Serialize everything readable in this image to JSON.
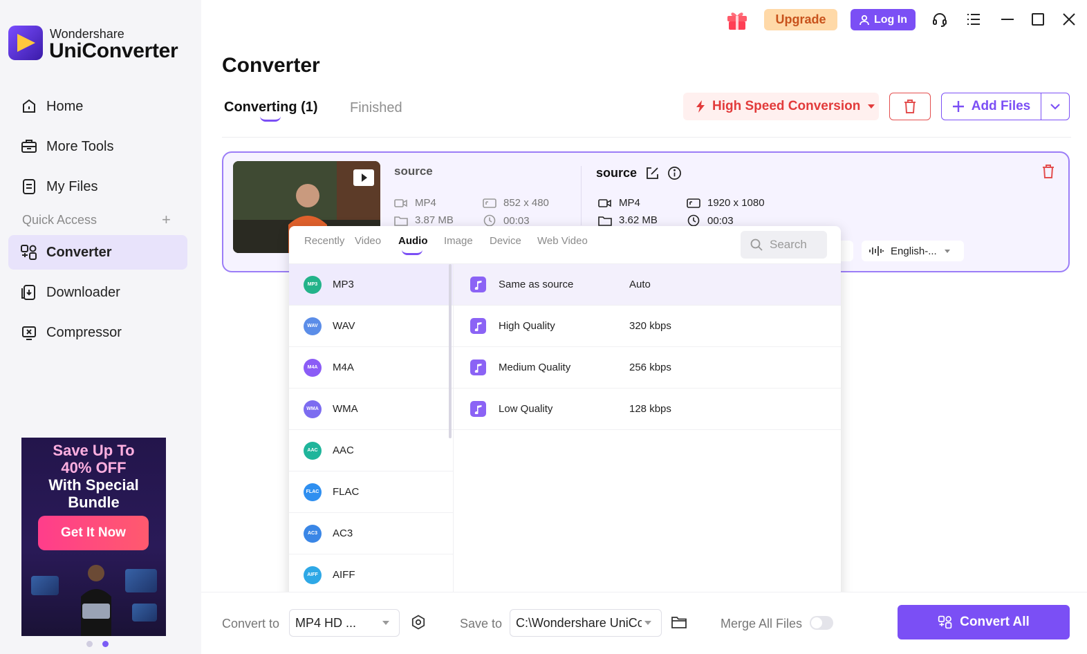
{
  "app": {
    "brand_top": "Wondershare",
    "brand_main": "UniConverter"
  },
  "sidebar": {
    "items": [
      {
        "label": "Home",
        "icon": "home-icon"
      },
      {
        "label": "More Tools",
        "icon": "toolbox-icon"
      },
      {
        "label": "My Files",
        "icon": "files-icon"
      }
    ],
    "quick_access_label": "Quick Access",
    "quick_items": [
      {
        "label": "Converter",
        "icon": "converter-icon",
        "active": true
      },
      {
        "label": "Downloader",
        "icon": "downloader-icon"
      },
      {
        "label": "Compressor",
        "icon": "compressor-icon"
      }
    ],
    "promo": {
      "line1": "Save Up To",
      "line2": "40% OFF",
      "line3": "With Special",
      "line4": "Bundle",
      "button": "Get It Now"
    }
  },
  "topbar": {
    "upgrade_label": "Upgrade",
    "login_label": "Log In"
  },
  "main": {
    "title": "Converter",
    "tabs": [
      {
        "label": "Converting (1)",
        "active": true
      },
      {
        "label": "Finished"
      }
    ],
    "high_speed_label": "High Speed Conversion",
    "add_files_label": "Add Files"
  },
  "file": {
    "source_title": "source",
    "source": {
      "format": "MP4",
      "size": "3.87 MB",
      "resolution": "852 x 480",
      "duration": "00:03"
    },
    "output_title": "source",
    "output": {
      "format": "MP4",
      "size": "3.62 MB",
      "resolution": "1920 x 1080",
      "duration": "00:03"
    },
    "audio_track": "English-..."
  },
  "format_panel": {
    "tabs": [
      "Recently",
      "Video",
      "Audio",
      "Image",
      "Device",
      "Web Video"
    ],
    "active_tab": "Audio",
    "search_placeholder": "Search",
    "formats": [
      {
        "label": "MP3",
        "badge": "MP3",
        "color": "#23b38a"
      },
      {
        "label": "WAV",
        "badge": "WAV",
        "color": "#5b8de8"
      },
      {
        "label": "M4A",
        "badge": "M4A",
        "color": "#8b5cf6"
      },
      {
        "label": "WMA",
        "badge": "WMA",
        "color": "#7c6cf0"
      },
      {
        "label": "AAC",
        "badge": "AAC",
        "color": "#1fb59b"
      },
      {
        "label": "FLAC",
        "badge": "FLAC",
        "color": "#2f8ff0"
      },
      {
        "label": "AC3",
        "badge": "AC3",
        "color": "#3a86e6"
      },
      {
        "label": "AIFF",
        "badge": "AIFF",
        "color": "#2ea8e6"
      }
    ],
    "qualities": [
      {
        "name": "Same as source",
        "bitrate": "Auto"
      },
      {
        "name": "High Quality",
        "bitrate": "320 kbps"
      },
      {
        "name": "Medium Quality",
        "bitrate": "256 kbps"
      },
      {
        "name": "Low Quality",
        "bitrate": "128 kbps"
      }
    ]
  },
  "bottom": {
    "convert_to_label": "Convert to",
    "convert_to_value": "MP4 HD ...",
    "save_to_label": "Save to",
    "save_to_value": "C:\\Wondershare UniCo",
    "merge_label": "Merge All Files",
    "convert_all_label": "Convert All"
  },
  "colors": {
    "accent": "#7b4ff5",
    "danger": "#e23b3b",
    "upgrade_bg": "#ffd9a8"
  }
}
